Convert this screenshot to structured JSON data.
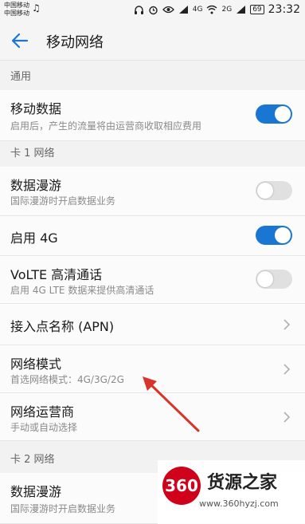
{
  "status": {
    "carrier_top": "中国移动",
    "carrier_bottom": "中国移动",
    "music_icon": "♫",
    "sig1": "4G",
    "sig2": "2G",
    "battery": "69",
    "time": "23:32"
  },
  "header": {
    "title": "移动网络"
  },
  "sections": {
    "general": "通用",
    "sim1": "卡 1 网络",
    "sim2": "卡 2 网络"
  },
  "rows": {
    "mobile_data": {
      "title": "移动数据",
      "subtitle": "启用后，产生的流量将由运营商收取相应费用",
      "on": true
    },
    "roaming1": {
      "title": "数据漫游",
      "subtitle": "国际漫游时开启数据业务",
      "on": false
    },
    "enable4g": {
      "title": "启用 4G",
      "on": true
    },
    "volte": {
      "title": "VoLTE 高清通话",
      "subtitle": "启用 4G LTE 数据来提供高清通话",
      "on": false
    },
    "apn": {
      "title": "接入点名称 (APN)"
    },
    "network_mode": {
      "title": "网络模式",
      "subtitle": "首选网络模式：4G/3G/2G"
    },
    "operator": {
      "title": "网络运营商",
      "subtitle": "手动或自动选择"
    },
    "roaming2": {
      "title": "数据漫游",
      "subtitle": "国际漫游时开启数据业务"
    }
  },
  "watermark": {
    "logo": "360",
    "name": "货源之家",
    "url": "www.360hyzj.com"
  },
  "colors": {
    "accent": "#1976d2",
    "annotation": "#d9342b"
  }
}
